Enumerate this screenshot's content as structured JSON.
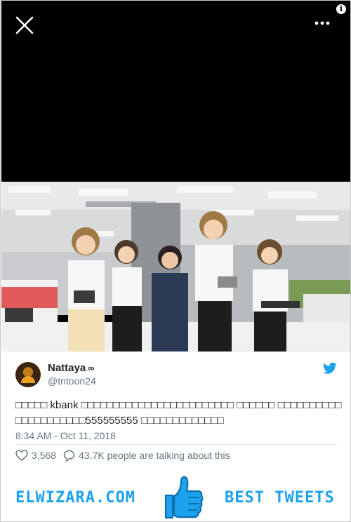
{
  "viewer": {
    "close_icon": "close-icon",
    "more_icon": "more-options-icon",
    "info_icon": "info-icon",
    "info_glyph": "i"
  },
  "tweet": {
    "display_name": "Nattaya",
    "name_badge": "∞",
    "handle": "@tntoon24",
    "text": "□□□□□ kbank □□□□□□□□□□□□□□□□□□□□□□□□ □□□□□□ □□□□□□□□□□□□□□□□□□□□□555555555 □□□□□□□□□□□□□",
    "timestamp": "8:34 AM - Oct 11, 2018",
    "likes": "3,568",
    "conversation": "43.7K people are talking about this",
    "accent": "#1da1f2"
  },
  "banner": {
    "left_text": "ELWIZARA.COM",
    "right_text": "BEST TWEETS",
    "color": "#1ca2ee"
  }
}
